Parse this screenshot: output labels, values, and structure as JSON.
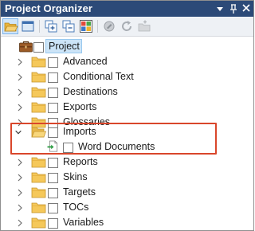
{
  "window": {
    "title": "Project Organizer",
    "controls": [
      "dropdown-icon",
      "pin-icon",
      "close-icon"
    ]
  },
  "toolbar": {
    "buttons": [
      {
        "icon": "open-folder-icon",
        "selected": true
      },
      {
        "icon": "panel-view-icon",
        "selected": false
      },
      {
        "icon": "expand-all-icon",
        "selected": false
      },
      {
        "icon": "collapse-all-icon",
        "selected": false
      },
      {
        "icon": "tile-view-icon",
        "selected": false
      },
      {
        "icon": "properties-icon",
        "disabled": true
      },
      {
        "icon": "refresh-icon",
        "disabled": true
      },
      {
        "icon": "add-folder-icon",
        "disabled": true
      }
    ]
  },
  "tree": {
    "root": {
      "label": "Project",
      "icon": "briefcase-icon",
      "selected": true
    },
    "items": [
      {
        "label": "Advanced",
        "expanded": false
      },
      {
        "label": "Conditional Text",
        "expanded": false
      },
      {
        "label": "Destinations",
        "expanded": false
      },
      {
        "label": "Exports",
        "expanded": false
      },
      {
        "label": "Glossaries",
        "expanded": false
      },
      {
        "label": "Imports",
        "expanded": true,
        "children": [
          {
            "label": "Word Documents",
            "icon": "import-file-icon"
          }
        ]
      },
      {
        "label": "Reports",
        "expanded": false
      },
      {
        "label": "Skins",
        "expanded": false
      },
      {
        "label": "Targets",
        "expanded": false
      },
      {
        "label": "TOCs",
        "expanded": false
      },
      {
        "label": "Variables",
        "expanded": false
      }
    ]
  },
  "colors": {
    "titlebar": "#2c4a78",
    "selection": "#cce4f7",
    "highlight_box": "#d9462b",
    "folder": "#f5c85a"
  }
}
